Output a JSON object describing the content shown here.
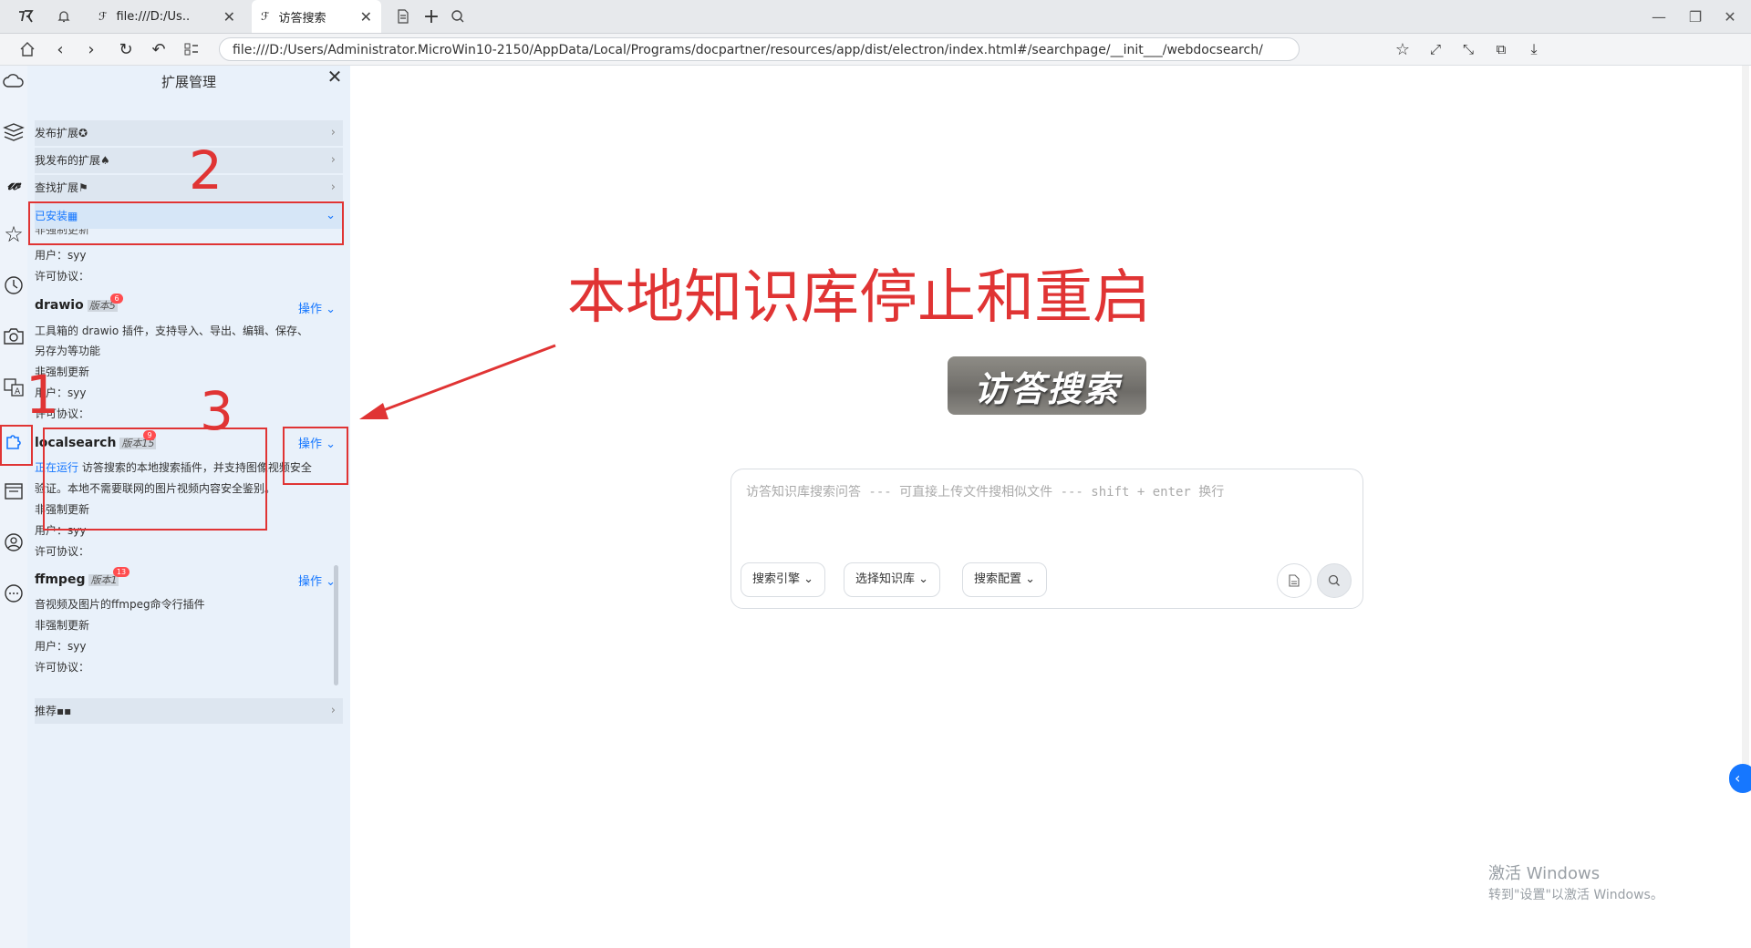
{
  "browser": {
    "tabs": [
      {
        "label": "file:///D:/Us.."
      },
      {
        "label": "访答搜索"
      }
    ],
    "url": "file:///D:/Users/Administrator.MicroWin10-2150/AppData/Local/Programs/docpartner/resources/app/dist/electron/index.html#/searchpage/__init___/webdocsearch/"
  },
  "panel": {
    "title": "扩展管理",
    "sections": {
      "publish": "发布扩展✪",
      "my_published": "我发布的扩展♠",
      "find": "查找扩展⚑",
      "installed": "已安装▦",
      "recommended": "推荐▪▪"
    },
    "partial": {
      "update": "非强制更新",
      "user": "用户：syy",
      "license": "许可协议："
    },
    "extensions": [
      {
        "name": "drawio",
        "version": "版本5",
        "badge": "6",
        "op": "操作",
        "desc1": "工具箱的 drawio 插件，支持导入、导出、编辑、保存、",
        "desc2": "另存为等功能",
        "update": "非强制更新",
        "user": "用户：syy",
        "license": "许可协议："
      },
      {
        "name": "localsearch",
        "version": "版本15",
        "badge": "9",
        "op": "操作",
        "status": "正在运行",
        "desc1": " 访答搜索的本地搜索插件，并支持图像视频安全",
        "desc2": "验证。本地不需要联网的图片视频内容安全鉴别。",
        "update": "非强制更新",
        "user": "用户：syy",
        "license": "许可协议："
      },
      {
        "name": "ffmpeg",
        "version": "版本1",
        "badge": "13",
        "op": "操作",
        "desc1": "音视频及图片的ffmpeg命令行插件",
        "update": "非强制更新",
        "user": "用户：syy",
        "license": "许可协议："
      }
    ]
  },
  "main": {
    "logo_text": "访答搜索",
    "search_placeholder": "访答知识库搜索问答 --- 可直接上传文件搜相似文件 --- shift + enter 换行",
    "buttons": {
      "engine": "搜索引擎",
      "kb": "选择知识库",
      "config": "搜索配置"
    }
  },
  "annotations": {
    "title": "本地知识库停止和重启",
    "n1": "1",
    "n2": "2",
    "n3": "3",
    "color": "#e03434"
  },
  "windows_activation": {
    "title": "激活 Windows",
    "subtitle": "转到\"设置\"以激活 Windows。"
  }
}
